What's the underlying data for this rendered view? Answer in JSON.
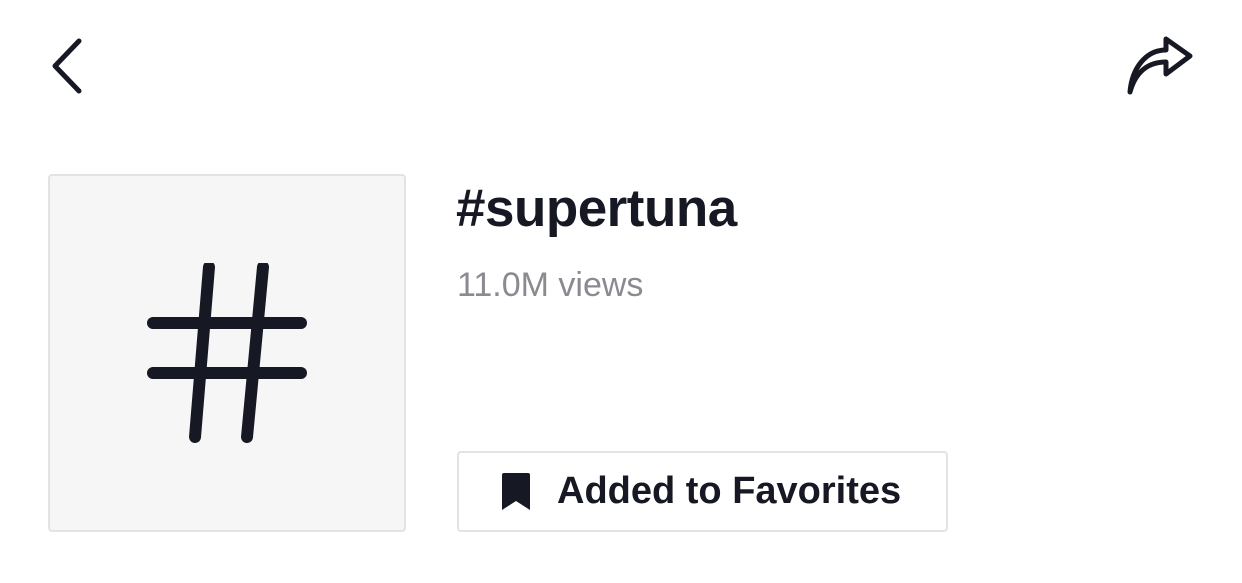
{
  "header": {
    "back_icon": "chevron-left-icon",
    "share_icon": "share-arrow-icon"
  },
  "hashtag": {
    "thumbnail_icon": "hashtag-icon",
    "title": "#supertuna",
    "views": "11.0M views"
  },
  "favorite_button": {
    "icon": "bookmark-icon",
    "label": "Added to Favorites"
  },
  "colors": {
    "text_primary": "#161823",
    "text_secondary": "#8a8b91",
    "border": "#e3e3e4",
    "thumbnail_bg": "#f6f6f6"
  }
}
